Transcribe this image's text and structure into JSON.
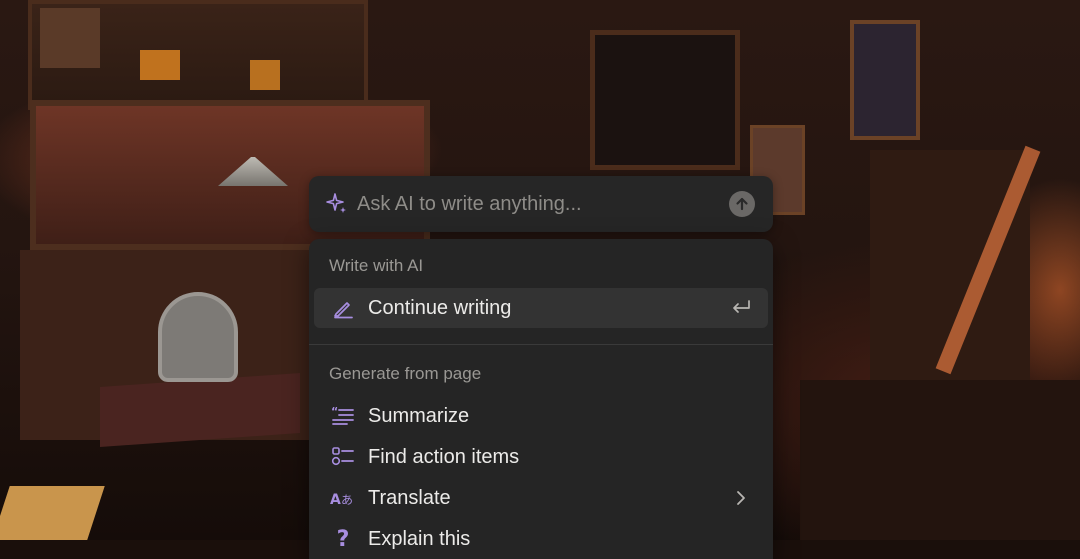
{
  "ask_ai": {
    "placeholder": "Ask AI to write anything...",
    "leading_icon": "sparkle-icon",
    "submit_icon": "arrow-up-icon"
  },
  "menu": {
    "sections": [
      {
        "heading": "Write with AI",
        "items": [
          {
            "label": "Continue writing",
            "icon": "pen-icon",
            "trailing": "enter-return-icon",
            "highlighted": true
          }
        ]
      },
      {
        "heading": "Generate from page",
        "items": [
          {
            "label": "Summarize",
            "icon": "summary-lines-icon"
          },
          {
            "label": "Find action items",
            "icon": "checklist-icon"
          },
          {
            "label": "Translate",
            "icon": "translate-icon",
            "trailing": "chevron-right-icon"
          },
          {
            "label": "Explain this",
            "icon": "question-mark-icon"
          }
        ]
      }
    ]
  },
  "colors": {
    "accent_purple": "#a88ee0",
    "panel": "#252525",
    "highlight_row": "#333333",
    "text_primary": "#ecebe9",
    "text_secondary": "#9a9894"
  }
}
